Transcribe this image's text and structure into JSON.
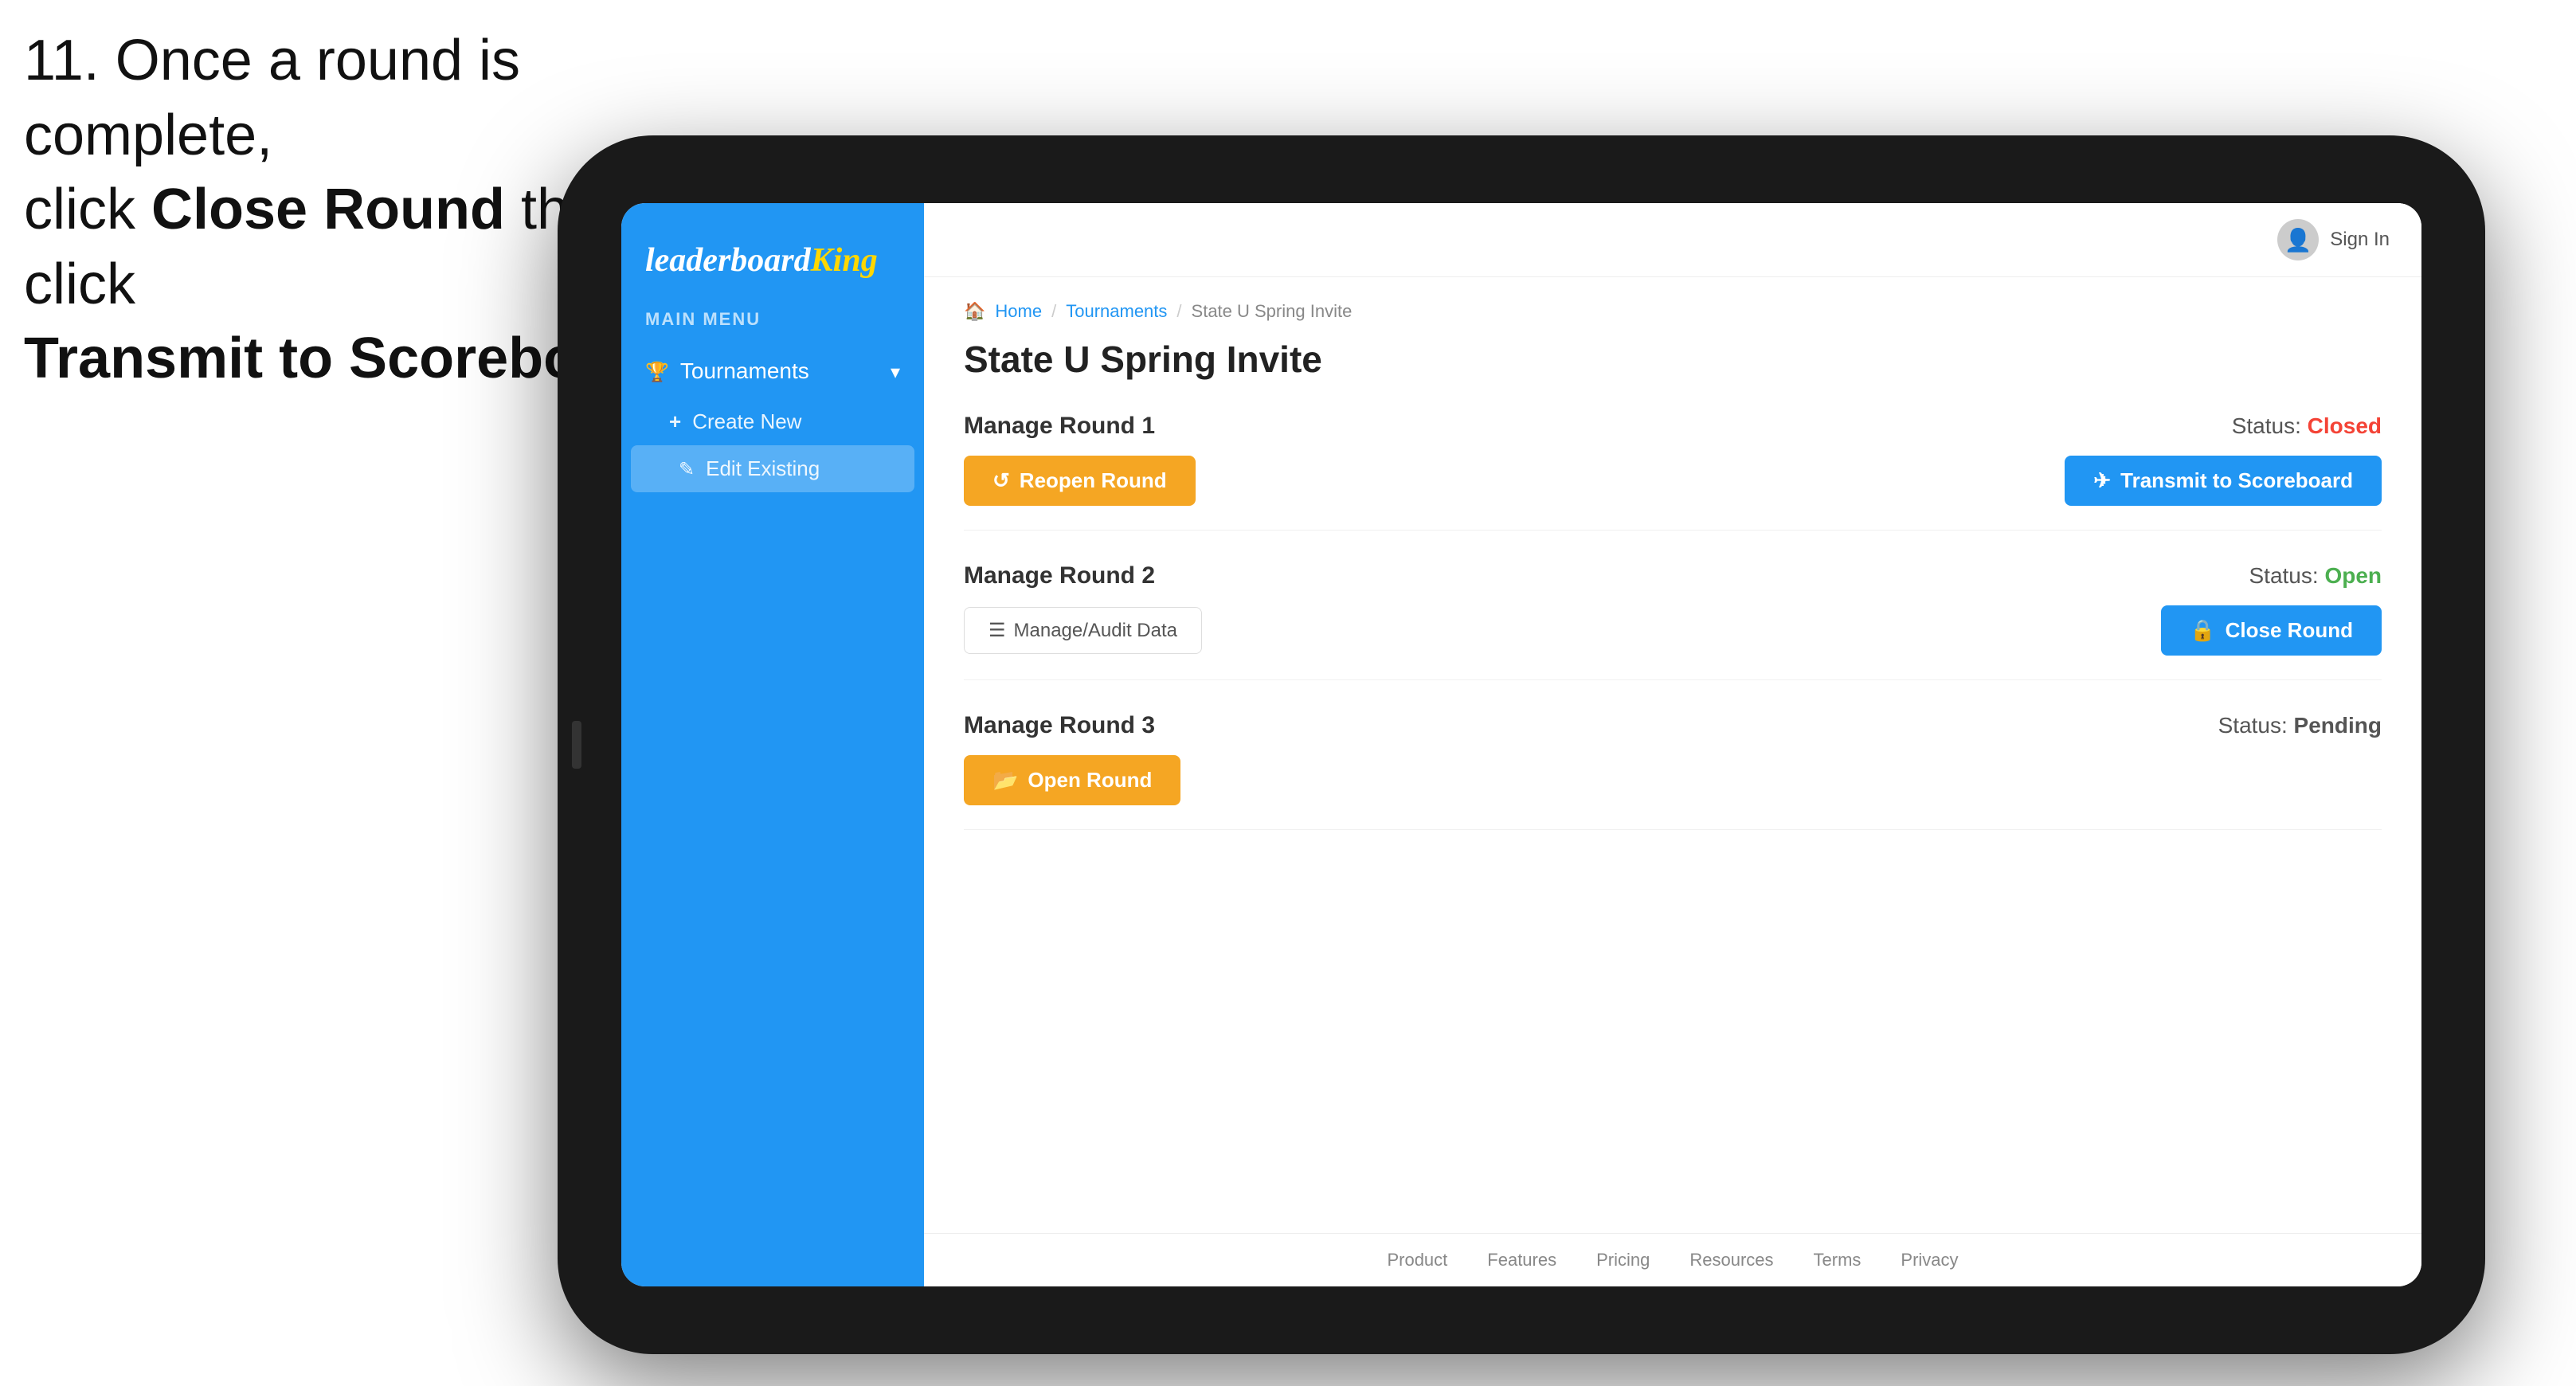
{
  "instruction": {
    "line1": "11. Once a round is complete,",
    "line2_prefix": "click ",
    "line2_bold": "Close Round",
    "line2_suffix": " then click",
    "line3": "Transmit to Scoreboard."
  },
  "header": {
    "sign_in": "Sign In"
  },
  "sidebar": {
    "logo_plain": "leaderboard",
    "logo_styled": "King",
    "menu_label": "MAIN MENU",
    "tournaments_label": "Tournaments",
    "create_new": "Create New",
    "edit_existing": "Edit Existing"
  },
  "breadcrumb": {
    "home": "Home",
    "sep1": "/",
    "tournaments": "Tournaments",
    "sep2": "/",
    "current": "State U Spring Invite"
  },
  "page": {
    "title": "State U Spring Invite"
  },
  "rounds": [
    {
      "id": "round1",
      "title": "Manage Round 1",
      "status_label": "Status:",
      "status_value": "Closed",
      "status_class": "status-closed",
      "left_button": "Reopen Round",
      "left_button_type": "gold",
      "right_button": "Transmit to Scoreboard",
      "right_button_type": "blue"
    },
    {
      "id": "round2",
      "title": "Manage Round 2",
      "status_label": "Status:",
      "status_value": "Open",
      "status_class": "status-open",
      "left_button": "Manage/Audit Data",
      "left_button_type": "outline",
      "right_button": "Close Round",
      "right_button_type": "blue"
    },
    {
      "id": "round3",
      "title": "Manage Round 3",
      "status_label": "Status:",
      "status_value": "Pending",
      "status_class": "status-pending",
      "left_button": "Open Round",
      "left_button_type": "gold",
      "right_button": null,
      "right_button_type": null
    }
  ],
  "footer": {
    "links": [
      "Product",
      "Features",
      "Pricing",
      "Resources",
      "Terms",
      "Privacy"
    ]
  },
  "arrow": {
    "color": "#e91e63"
  }
}
